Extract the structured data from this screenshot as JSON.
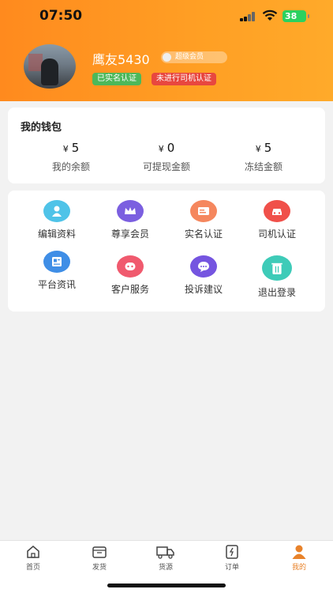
{
  "status_bar": {
    "time": "07:50",
    "battery": "38"
  },
  "profile": {
    "username": "鹰友5430",
    "member_badge": "超级会员",
    "tags": [
      "已实名认证",
      "未进行司机认证"
    ]
  },
  "wallet": {
    "title": "我的钱包",
    "currency": "¥",
    "items": [
      {
        "value": "5",
        "label": "我的余额"
      },
      {
        "value": "0",
        "label": "可提现金额"
      },
      {
        "value": "5",
        "label": "冻结金额"
      }
    ]
  },
  "menu": [
    {
      "label": "编辑资料",
      "icon": "person-icon",
      "color": "#4fc3e8"
    },
    {
      "label": "尊享会员",
      "icon": "crown-icon",
      "color": "#7b5fe0"
    },
    {
      "label": "实名认证",
      "icon": "id-card-icon",
      "color": "#f5875e"
    },
    {
      "label": "司机认证",
      "icon": "car-icon",
      "color": "#f0504a"
    },
    {
      "label": "平台资讯",
      "icon": "news-icon",
      "color": "#3f8ee6"
    },
    {
      "label": "客户服务",
      "icon": "service-icon",
      "color": "#f05a6e"
    },
    {
      "label": "投诉建议",
      "icon": "chat-icon",
      "color": "#7555e0"
    },
    {
      "label": "退出登录",
      "icon": "trash-icon",
      "color": "#3ecbb8"
    }
  ],
  "tabbar": [
    {
      "label": "首页",
      "icon": "home-icon"
    },
    {
      "label": "发货",
      "icon": "box-icon"
    },
    {
      "label": "货源",
      "icon": "truck-icon"
    },
    {
      "label": "订单",
      "icon": "order-icon"
    },
    {
      "label": "我的",
      "icon": "user-icon",
      "active": true
    }
  ],
  "colors": {
    "header_start": "#ff8a1e",
    "header_end": "#ffaa2a",
    "active_tab": "#e8822a"
  }
}
